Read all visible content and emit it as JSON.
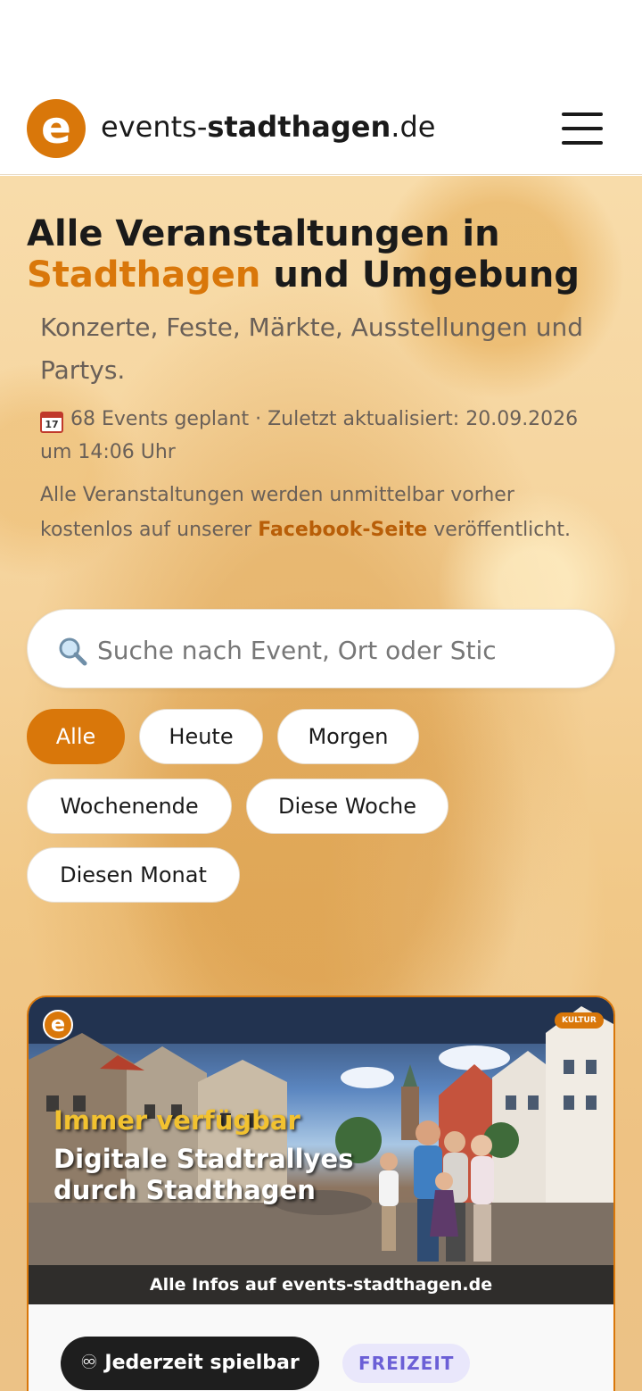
{
  "header": {
    "logo_letter": "e",
    "brand_prefix": "events-",
    "brand_bold": "stadthagen",
    "brand_suffix": ".de",
    "menu_icon": "hamburger-menu-icon"
  },
  "hero": {
    "title_line1": "Alle Veranstaltungen in",
    "title_accent": "Stadthagen",
    "title_rest": " und Umgebung",
    "subtitle": "Konzerte, Feste, Märkte, Ausstellungen und Partys.",
    "meta_icon": "calendar-icon",
    "meta_text": "68 Events geplant · Zuletzt aktualisiert: 20.09.2026 um 14:06 Uhr",
    "notice_before": "Alle Veranstaltungen werden unmittelbar vorher kostenlos auf unserer ",
    "notice_link": "Facebook-Seite",
    "notice_after": " veröffentlicht."
  },
  "search": {
    "icon": "search-icon",
    "placeholder": "Suche nach Event, Ort oder Stic",
    "value": ""
  },
  "filters": {
    "selected": "Alle",
    "items": [
      "Alle",
      "Heute",
      "Morgen",
      "Wochenende",
      "Diese Woche",
      "Diesen Monat"
    ]
  },
  "card": {
    "logo_letter": "e",
    "category_tag": "KULTUR",
    "headline_1": "Immer verfügbar",
    "headline_2": "Digitale Stadtrallyes durch Stadthagen",
    "footer": "Alle Infos auf events-stadthagen.de",
    "badge": "♾ Jederzeit spielbar",
    "category": "FREIZEIT"
  },
  "colors": {
    "accent": "#d9770a",
    "text": "#1a1a1a",
    "muted": "#6a6058",
    "link": "#b85e08",
    "category_badge_bg": "#e9e7fb",
    "category_badge_text": "#6b5fd6"
  }
}
